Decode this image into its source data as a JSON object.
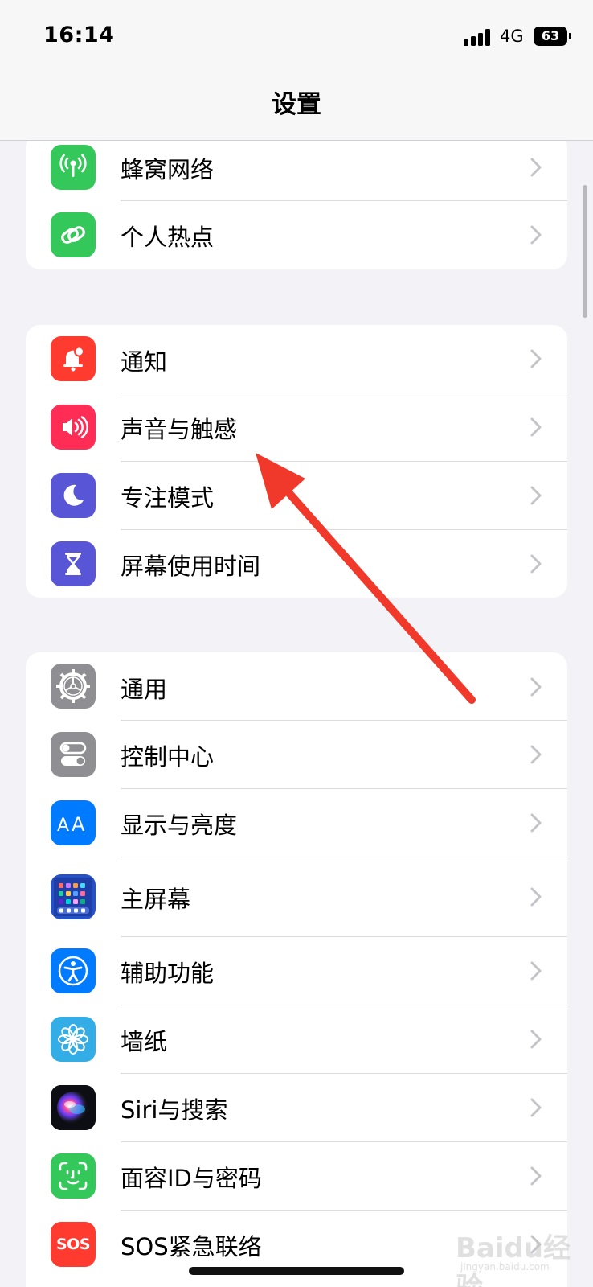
{
  "status_bar": {
    "time": "16:14",
    "network": "4G",
    "battery": "63"
  },
  "nav": {
    "title": "设置"
  },
  "groups": [
    {
      "items": [
        {
          "label": "蜂窝网络",
          "icon": "cellular-antenna-icon",
          "color": "#34c759"
        },
        {
          "label": "个人热点",
          "icon": "personal-hotspot-link-icon",
          "color": "#34c759"
        }
      ]
    },
    {
      "items": [
        {
          "label": "通知",
          "icon": "notification-bell-icon",
          "color": "#ff3b30"
        },
        {
          "label": "声音与触感",
          "icon": "speaker-icon",
          "color": "#ff2d55"
        },
        {
          "label": "专注模式",
          "icon": "moon-icon",
          "color": "#5856d6"
        },
        {
          "label": "屏幕使用时间",
          "icon": "hourglass-icon",
          "color": "#5856d6"
        }
      ]
    },
    {
      "items": [
        {
          "label": "通用",
          "icon": "gear-icon",
          "color": "#8e8e93"
        },
        {
          "label": "控制中心",
          "icon": "toggles-icon",
          "color": "#8e8e93"
        },
        {
          "label": "显示与亮度",
          "icon": "text-size-icon",
          "color": "#007aff"
        },
        {
          "label": "主屏幕",
          "icon": "home-screen-grid-icon",
          "color": "#2450c8"
        },
        {
          "label": "辅助功能",
          "icon": "accessibility-icon",
          "color": "#007aff"
        },
        {
          "label": "墙纸",
          "icon": "flower-icon",
          "color": "#32ade6"
        },
        {
          "label": "Siri与搜索",
          "icon": "siri-orb-icon",
          "color": "#1c1c1e"
        },
        {
          "label": "面容ID与密码",
          "icon": "face-id-icon",
          "color": "#34c759"
        },
        {
          "label": "SOS紧急联络",
          "icon": "sos-icon",
          "color": "#ff3b30",
          "icon_text": "SOS"
        }
      ]
    }
  ],
  "annotation": {
    "arrow_color": "#f0392b"
  },
  "watermark": {
    "text": "Baidu经验",
    "sub": "jingyan.baidu.com"
  }
}
